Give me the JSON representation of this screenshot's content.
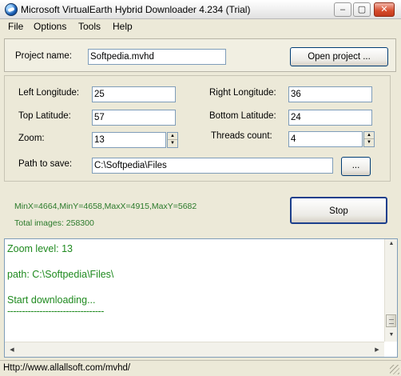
{
  "window": {
    "title": "Microsoft VirtualEarth Hybrid Downloader 4.234 (Trial)",
    "controls": {
      "minimize": "–",
      "maximize": "▢",
      "close": "✕"
    }
  },
  "menu": [
    "File",
    "Options",
    "Tools",
    "Help"
  ],
  "project": {
    "name_label": "Project name:",
    "name_value": "Softpedia.mvhd",
    "open_button": "Open project ..."
  },
  "params": {
    "left_longitude_label": "Left Longitude:",
    "left_longitude_value": "25",
    "right_longitude_label": "Right Longitude:",
    "right_longitude_value": "36",
    "top_latitude_label": "Top Latitude:",
    "top_latitude_value": "57",
    "bottom_latitude_label": "Bottom Latitude:",
    "bottom_latitude_value": "24",
    "zoom_label": "Zoom:",
    "zoom_value": "13",
    "threads_label": "Threads count:",
    "threads_value": "4",
    "path_label": "Path to save:",
    "path_value": "C:\\Softpedia\\Files",
    "browse_button": "..."
  },
  "info": {
    "bounds": "MinX=4664,MinY=4658,MaxX=4915,MaxY=5682",
    "total_images": "Total images: 258300",
    "stop_button": "Stop"
  },
  "log": [
    "Zoom level: 13",
    "path: C:\\Softpedia\\Files\\",
    "Start downloading...",
    "---------------------------------"
  ],
  "status": "Http://www.allallsoft.com/mvhd/",
  "icons": {
    "app": "globe-icon",
    "spin_up": "▲",
    "spin_down": "▼",
    "scroll_up": "▲",
    "scroll_down": "▼",
    "scroll_left": "◀",
    "scroll_right": "▶"
  },
  "colors": {
    "log_text": "#1f8a1f",
    "info_text": "#2a7a2a",
    "window_bg": "#ece9d8"
  }
}
